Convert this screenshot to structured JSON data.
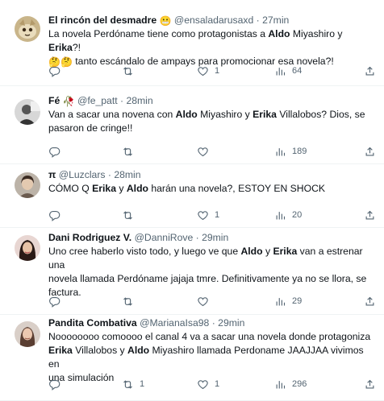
{
  "tweets": [
    {
      "name": "El rincón del desmadre",
      "name_emoji": "😬",
      "handle": "@ensaladarusaxd",
      "time": "27min",
      "line1": {
        "a": "La novela Perdóname tiene como protagonistas a ",
        "b1": "Aldo",
        "c": " Miyashiro y ",
        "b2": "Erika",
        "d": "?!"
      },
      "line2": {
        "emoji": "🤔🤔",
        "text": " tanto escándalo de ampays para promocionar esa novela?!"
      },
      "reply_count": "",
      "retweet_count": "",
      "like_count": "1",
      "view_count": "64"
    },
    {
      "name": "Fé",
      "name_emoji": "🥀",
      "handle": "@fe_patt",
      "time": "28min",
      "line1": {
        "a": "Van a sacar una novena con ",
        "b1": "Aldo",
        "c": " Miyashiro y ",
        "b2": "Erika",
        "d": " Villalobos? Dios, se"
      },
      "line2": {
        "text": "pasaron de cringe!!"
      },
      "reply_count": "",
      "retweet_count": "",
      "like_count": "",
      "view_count": "189"
    },
    {
      "name": "π",
      "handle": "@Luzclars",
      "time": "28min",
      "line1": {
        "a": "CÓMO Q ",
        "b1": "Erika",
        "c": " y ",
        "b2": "Aldo",
        "d": " harán una novela?, ESTOY EN SHOCK"
      },
      "reply_count": "",
      "retweet_count": "",
      "like_count": "1",
      "view_count": "20"
    },
    {
      "name": "Dani Rodriguez V.",
      "handle": "@DanniRove",
      "time": "29min",
      "line1": {
        "a": "Uno cree haberlo visto todo, y luego ve que ",
        "b1": "Aldo",
        "c": " y ",
        "b2": "Erika",
        "d": " van a estrenar una"
      },
      "line2": {
        "text": "novela llamada Perdóname jajaja tmre. Definitivamente ya no se llora, se"
      },
      "line3": {
        "text": "factura."
      },
      "reply_count": "",
      "retweet_count": "",
      "like_count": "",
      "view_count": "29"
    },
    {
      "name": "Pandita Combativa",
      "handle": "@MarianaIsa98",
      "time": "29min",
      "line1": {
        "text": "Noooooooo comoooo el canal 4 va a sacar una novela donde protagoniza"
      },
      "line2": {
        "b1": "Erika",
        "a": " Villalobos y ",
        "b2": "Aldo",
        "c": " Miyashiro llamada Perdoname  JAAJJAA vivimos en"
      },
      "line3": {
        "text": "una simulación"
      },
      "reply_count": "",
      "retweet_count": "1",
      "like_count": "1",
      "view_count": "296"
    }
  ]
}
